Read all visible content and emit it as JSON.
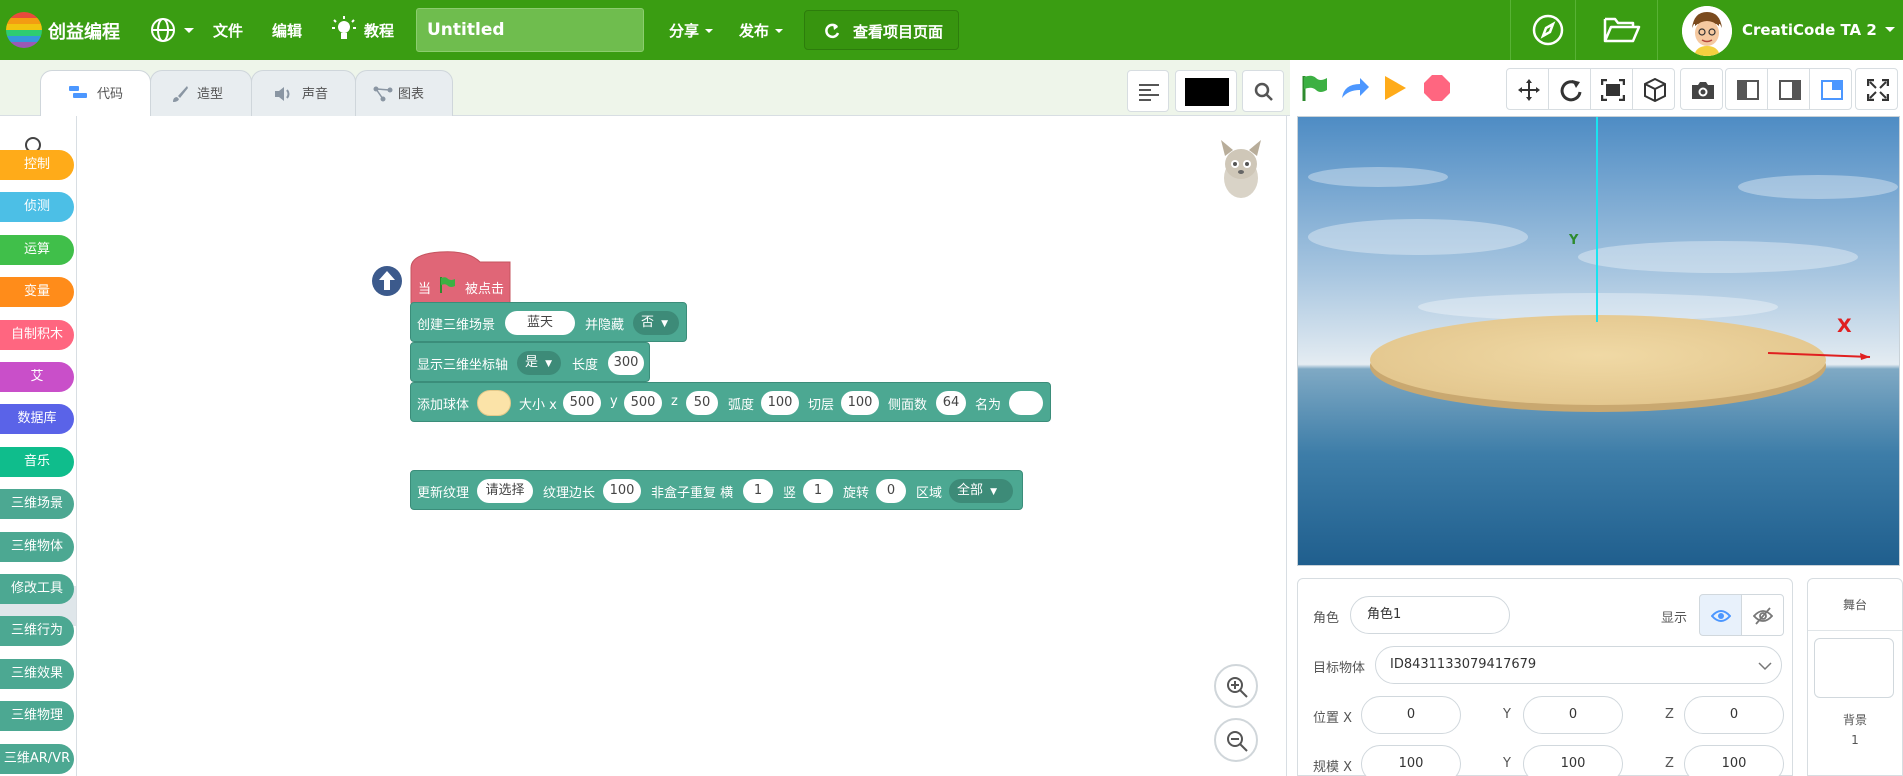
{
  "brand": {
    "name": "创益编程"
  },
  "nav": {
    "file": "文件",
    "edit": "编辑",
    "tutorial": "教程",
    "share": "分享",
    "publish": "发布",
    "view_project": "查看项目页面"
  },
  "project": {
    "title": "Untitled"
  },
  "user": {
    "name": "CreatiCode TA 2"
  },
  "tabs": [
    {
      "label": "代码",
      "active": true
    },
    {
      "label": "造型",
      "active": false
    },
    {
      "label": "声音",
      "active": false
    },
    {
      "label": "图表",
      "active": false
    }
  ],
  "palette": {
    "categories": [
      {
        "label": "控制",
        "color": "#ffab19"
      },
      {
        "label": "侦测",
        "color": "#4cbfe6"
      },
      {
        "label": "运算",
        "color": "#40bf4a"
      },
      {
        "label": "变量",
        "color": "#ff8c1a"
      },
      {
        "label": "自制积木",
        "color": "#ff6680"
      },
      {
        "label": "艾",
        "color": "#c94fc9"
      },
      {
        "label": "数据库",
        "color": "#5a63e8"
      },
      {
        "label": "音乐",
        "color": "#0fbd8c"
      },
      {
        "label": "三维场景",
        "color": "#4ca892"
      },
      {
        "label": "三维物体",
        "color": "#4ca892"
      },
      {
        "label": "修改工具",
        "color": "#4ca892"
      },
      {
        "label": "三维行为",
        "color": "#4ca892"
      },
      {
        "label": "三维效果",
        "color": "#4ca892"
      },
      {
        "label": "三维物理",
        "color": "#4ca892"
      },
      {
        "label": "三维AR/VR",
        "color": "#4ca892"
      }
    ]
  },
  "blocks": {
    "hat": {
      "when": "当",
      "clicked": "被点击"
    },
    "create_scene": {
      "label": "创建三维场景",
      "scene": "蓝天",
      "hide_label": "并隐藏",
      "hide_value": "否"
    },
    "show_axis": {
      "label": "显示三维坐标轴",
      "value": "是",
      "length_label": "长度",
      "length": "300"
    },
    "add_sphere": {
      "label": "添加球体",
      "size_label": "大小 x",
      "x": "500",
      "y_label": "y",
      "y": "500",
      "z_label": "z",
      "z": "50",
      "arc_label": "弧度",
      "arc": "100",
      "slice_label": "切层",
      "slice": "100",
      "sides_label": "侧面数",
      "sides": "64",
      "name_label": "名为",
      "name": ""
    },
    "update_texture": {
      "label": "更新纹理",
      "texture": "请选择",
      "edge_label": "纹理边长",
      "edge": "100",
      "repeat_label": "非盒子重复 横",
      "h": "1",
      "v_label": "竖",
      "v": "1",
      "rotate_label": "旋转",
      "rotate": "0",
      "area_label": "区域",
      "area": "全部"
    }
  },
  "stage": {
    "axis_y": "Y",
    "axis_x": "X"
  },
  "sprite": {
    "role_label": "角色",
    "role_name": "角色1",
    "show_label": "显示",
    "target_label": "目标物体",
    "target_value": "ID8431133079417679",
    "pos_label": "位置 X",
    "pos_x": "0",
    "pos_y_label": "Y",
    "pos_y": "0",
    "pos_z_label": "Z",
    "pos_z": "0",
    "scale_label": "规模 X",
    "scale_x": "100",
    "scale_y_label": "Y",
    "scale_y": "100",
    "scale_z_label": "Z",
    "scale_z": "100"
  },
  "stage_panel": {
    "title": "舞台",
    "backdrop_label": "背景",
    "backdrop_count": "1"
  },
  "colors": {
    "topbar": "#3a9d12",
    "scene3d": "#4ca892",
    "hat": "#e06677"
  }
}
